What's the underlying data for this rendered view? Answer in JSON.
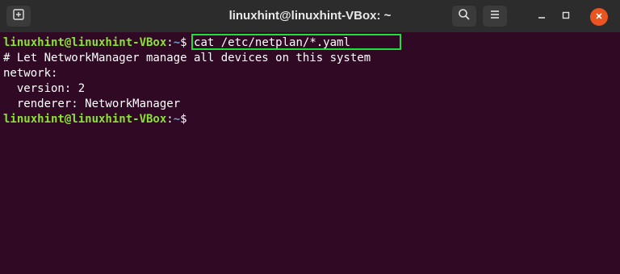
{
  "window": {
    "title": "linuxhint@linuxhint-VBox: ~",
    "colors": {
      "titlebar": "#2c2c2c",
      "background": "#300a24",
      "prompt_user": "#8ae234",
      "prompt_path": "#729fcf",
      "close": "#e95420",
      "highlight": "#1ee03a"
    }
  },
  "titlebar": {
    "new_tab_icon": "new-tab-icon",
    "search_icon": "search-icon",
    "menu_icon": "hamburger-menu-icon",
    "minimize_icon": "minimize-icon",
    "maximize_icon": "maximize-icon",
    "close_icon": "close-icon"
  },
  "terminal": {
    "lines": [
      {
        "prompt_user": "linuxhint@linuxhint-VBox",
        "prompt_sep": ":",
        "prompt_path": "~",
        "command": "$ cat /etc/netplan/*.yaml"
      },
      {
        "text": "# Let NetworkManager manage all devices on this system"
      },
      {
        "text": "network:"
      },
      {
        "text": "  version: 2"
      },
      {
        "text": "  renderer: NetworkManager"
      },
      {
        "prompt_user": "linuxhint@linuxhint-VBox",
        "prompt_sep": ":",
        "prompt_path": "~",
        "command": "$"
      }
    ]
  }
}
